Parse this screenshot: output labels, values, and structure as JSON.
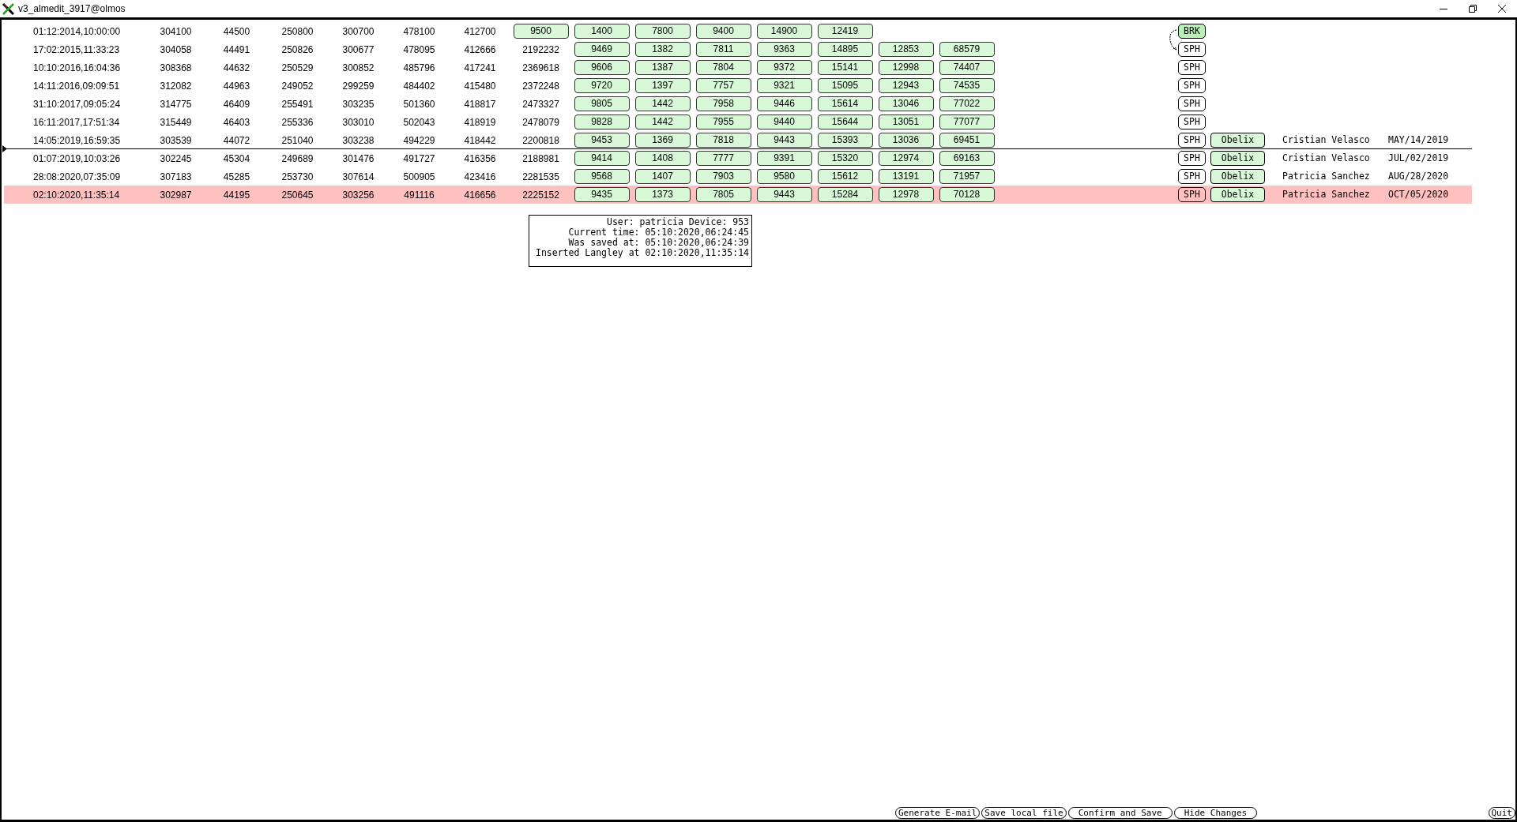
{
  "window": {
    "title": "v3_almedit_3917@olmos"
  },
  "rows": [
    {
      "date": "01:12:2014,10:00:00",
      "values": [
        "304100",
        "44500",
        "250800",
        "300700",
        "478100",
        "412700"
      ],
      "boxes": [
        "9500",
        "1400",
        "7800",
        "9400",
        "14900",
        "12419"
      ],
      "tag": {
        "text": "BRK",
        "highlighted": true
      },
      "selected": false,
      "divider_below": false
    },
    {
      "date": "17:02:2015,11:33:23",
      "values": [
        "304058",
        "44491",
        "250826",
        "300677",
        "478095",
        "412666",
        "2192232"
      ],
      "boxes": [
        "9469",
        "1382",
        "7811",
        "9363",
        "14895",
        "12853",
        "68579"
      ],
      "tag": {
        "text": "SPH",
        "highlighted": false
      },
      "selected": false,
      "divider_below": false
    },
    {
      "date": "10:10:2016,16:04:36",
      "values": [
        "308368",
        "44632",
        "250529",
        "300852",
        "485796",
        "417241",
        "2369618"
      ],
      "boxes": [
        "9606",
        "1387",
        "7804",
        "9372",
        "15141",
        "12998",
        "74407"
      ],
      "tag": {
        "text": "SPH",
        "highlighted": false
      },
      "selected": false,
      "divider_below": false
    },
    {
      "date": "14:11:2016,09:09:51",
      "values": [
        "312082",
        "44963",
        "249052",
        "299259",
        "484402",
        "415480",
        "2372248"
      ],
      "boxes": [
        "9720",
        "1397",
        "7757",
        "9321",
        "15095",
        "12943",
        "74535"
      ],
      "tag": {
        "text": "SPH",
        "highlighted": false
      },
      "selected": false,
      "divider_below": false
    },
    {
      "date": "31:10:2017,09:05:24",
      "values": [
        "314775",
        "46409",
        "255491",
        "303235",
        "501360",
        "418817",
        "2473327"
      ],
      "boxes": [
        "9805",
        "1442",
        "7958",
        "9446",
        "15614",
        "13046",
        "77022"
      ],
      "tag": {
        "text": "SPH",
        "highlighted": false
      },
      "selected": false,
      "divider_below": false
    },
    {
      "date": "16:11:2017,17:51:34",
      "values": [
        "315449",
        "46403",
        "255336",
        "303010",
        "502043",
        "418919",
        "2478079"
      ],
      "boxes": [
        "9828",
        "1442",
        "7955",
        "9440",
        "15644",
        "13051",
        "77077"
      ],
      "tag": {
        "text": "SPH",
        "highlighted": false
      },
      "selected": false,
      "divider_below": false
    },
    {
      "date": "14:05:2019,16:59:35",
      "values": [
        "303539",
        "44072",
        "251040",
        "303238",
        "494229",
        "418442",
        "2200818"
      ],
      "boxes": [
        "9453",
        "1369",
        "7818",
        "9443",
        "15393",
        "13036",
        "69451"
      ],
      "tag": {
        "text": "SPH",
        "highlighted": false
      },
      "source": "Obelix",
      "user": "Cristian Velasco",
      "changed": "MAY/14/2019",
      "selected": false,
      "divider_below": true
    },
    {
      "date": "01:07:2019,10:03:26",
      "values": [
        "302245",
        "45304",
        "249689",
        "301476",
        "491727",
        "416356",
        "2188981"
      ],
      "boxes": [
        "9414",
        "1408",
        "7777",
        "9391",
        "15320",
        "12974",
        "69163"
      ],
      "tag": {
        "text": "SPH",
        "highlighted": false
      },
      "source": "Obelix",
      "user": "Cristian Velasco",
      "changed": "JUL/02/2019",
      "selected": false,
      "divider_below": false
    },
    {
      "date": "28:08:2020,07:35:09",
      "values": [
        "307183",
        "45285",
        "253730",
        "307614",
        "500905",
        "423416",
        "2281535"
      ],
      "boxes": [
        "9568",
        "1407",
        "7903",
        "9580",
        "15612",
        "13191",
        "71957"
      ],
      "tag": {
        "text": "SPH",
        "highlighted": false
      },
      "source": "Obelix",
      "user": "Patricia Sanchez",
      "changed": "AUG/28/2020",
      "selected": false,
      "divider_below": false
    },
    {
      "date": "02:10:2020,11:35:14",
      "values": [
        "302987",
        "44195",
        "250645",
        "303256",
        "491116",
        "416656",
        "2225152"
      ],
      "boxes": [
        "9435",
        "1373",
        "7805",
        "9443",
        "15284",
        "12978",
        "70128"
      ],
      "tag": {
        "text": "SPH",
        "highlighted": false
      },
      "source": "Obelix",
      "user": "Patricia Sanchez",
      "changed": "OCT/05/2020",
      "selected": true,
      "divider_below": false
    }
  ],
  "tooltip": {
    "lines": [
      "User: patricia Device: 953",
      "Current time: 05:10:2020,06:24:45",
      "Was saved at: 05:10:2020,06:24:39",
      "Inserted Langley at 02:10:2020,11:35:14"
    ]
  },
  "buttons": [
    "Generate E-mail",
    "Save local file",
    "Confirm and Save",
    "Hide Changes"
  ],
  "quit": "Quit"
}
